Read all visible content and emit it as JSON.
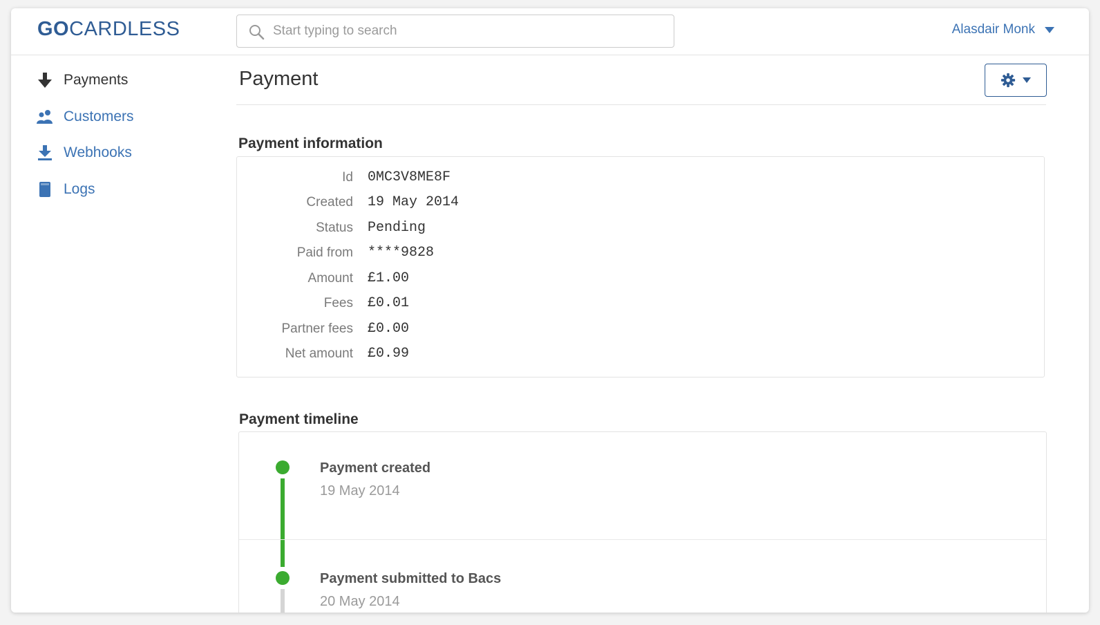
{
  "header": {
    "logo_bold": "GO",
    "logo_rest": "CARDLESS",
    "search_placeholder": "Start typing to search",
    "user_name": "Alasdair Monk"
  },
  "sidebar": {
    "items": [
      {
        "label": "Payments",
        "icon": "arrow-down-icon",
        "active": true
      },
      {
        "label": "Customers",
        "icon": "users-icon",
        "active": false
      },
      {
        "label": "Webhooks",
        "icon": "download-icon",
        "active": false
      },
      {
        "label": "Logs",
        "icon": "book-icon",
        "active": false
      }
    ]
  },
  "main": {
    "title": "Payment",
    "settings_icon": "gear-icon",
    "info_heading": "Payment information",
    "info": [
      {
        "label": "Id",
        "value": "0MC3V8ME8F"
      },
      {
        "label": "Created",
        "value": "19 May 2014"
      },
      {
        "label": "Status",
        "value": "Pending"
      },
      {
        "label": "Paid from",
        "value": "****9828"
      },
      {
        "label": "Amount",
        "value": "£1.00"
      },
      {
        "label": "Fees",
        "value": "£0.01"
      },
      {
        "label": "Partner fees",
        "value": "£0.00"
      },
      {
        "label": "Net amount",
        "value": "£0.99"
      }
    ],
    "timeline_heading": "Payment timeline",
    "timeline": [
      {
        "title": "Payment created",
        "date": "19 May 2014"
      },
      {
        "title": "Payment submitted to Bacs",
        "date": "20 May 2014"
      }
    ]
  },
  "colors": {
    "brand": "#2f5c94",
    "link": "#3c73b4",
    "timeline_green": "#3bab30"
  }
}
